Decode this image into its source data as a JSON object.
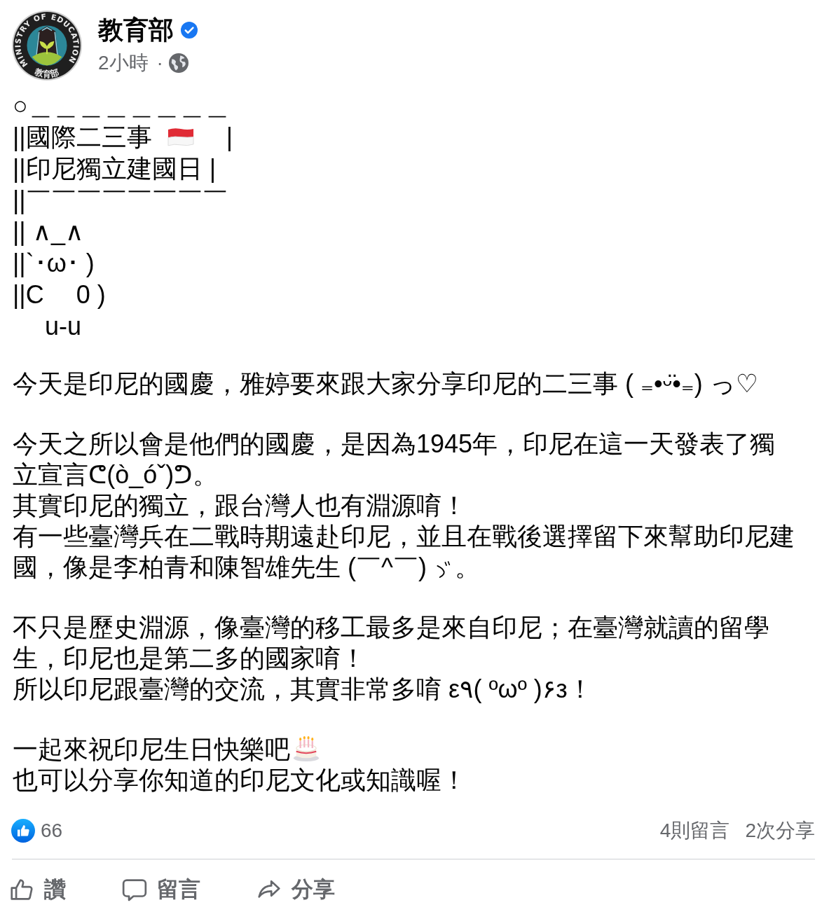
{
  "author": {
    "name": "教育部",
    "verified": true,
    "avatar": {
      "ring_text": "MINISTRY OF EDUCATION",
      "bottom_text": "教育部"
    }
  },
  "meta": {
    "time": "2小時",
    "separator": "·"
  },
  "ascii_art": [
    [
      {
        "kind": "text",
        "text": "○＿＿＿＿＿＿＿＿"
      }
    ],
    [
      {
        "kind": "text",
        "text": "||國際二三事"
      },
      {
        "kind": "flag"
      },
      {
        "kind": "text",
        "text": "|"
      }
    ],
    [
      {
        "kind": "text",
        "text": "||印尼獨立建國日 |"
      }
    ],
    [
      {
        "kind": "text",
        "text": "||￣￣￣￣￣￣￣￣"
      }
    ],
    [
      {
        "kind": "text",
        "text": "|| ∧_∧"
      }
    ],
    [
      {
        "kind": "text",
        "text": "||`･ω･ )"
      }
    ],
    [
      {
        "kind": "text",
        "text": "||C　 0 )"
      }
    ],
    [
      {
        "kind": "text",
        "text": "　 u-u"
      }
    ]
  ],
  "paragraphs": [
    [
      [
        {
          "kind": "text",
          "text": "今天是印尼的國慶，雅婷要來跟大家分享印尼的二三事 ( ₌•ᵕ̈•₌) っ♡"
        }
      ]
    ],
    [
      [
        {
          "kind": "text",
          "text": "今天之所以會是他們的國慶，是因為1945年，印尼在這一天發表了獨立宣言ᕦ(ò_óˇ)ᕤ。"
        }
      ],
      [
        {
          "kind": "text",
          "text": "其實印尼的獨立，跟台灣人也有淵源唷！"
        }
      ],
      [
        {
          "kind": "text",
          "text": "有一些臺灣兵在二戰時期遠赴印尼，並且在戰後選擇留下來幫助印尼建"
        }
      ],
      [
        {
          "kind": "text",
          "text": "國，像是李柏青和陳智雄先生 (￣^￣)"
        },
        {
          "kind": "salute_mark"
        },
        {
          "kind": "text",
          "text": "。"
        }
      ]
    ],
    [
      [
        {
          "kind": "text",
          "text": "不只是歷史淵源，像臺灣的移工最多是來自印尼；在臺灣就讀的留學生，印尼也是第二多的國家唷！"
        }
      ],
      [
        {
          "kind": "text",
          "text": "所以印尼跟臺灣的交流，其實非常多唷 ε٩( ºωº )۶з！"
        }
      ]
    ],
    [
      [
        {
          "kind": "text",
          "text": "一起來祝印尼生日快樂吧"
        },
        {
          "kind": "cake"
        }
      ],
      [
        {
          "kind": "text",
          "text": "也可以分享你知道的印尼文化或知識喔！"
        }
      ]
    ]
  ],
  "stats": {
    "reactions": "66",
    "comments": "4則留言",
    "shares": "2次分享"
  },
  "actions": [
    {
      "kind": "like",
      "label": "讚"
    },
    {
      "kind": "comment",
      "label": "留言"
    },
    {
      "kind": "share",
      "label": "分享"
    }
  ]
}
